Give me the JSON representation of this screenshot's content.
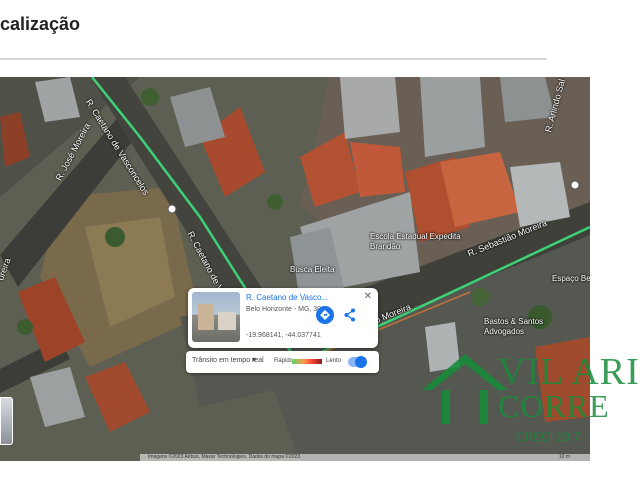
{
  "page": {
    "section_title": "calização"
  },
  "map": {
    "view": "satellite",
    "route_color": "#3dd178",
    "streets": {
      "jose_moreira": "R. José Moreira",
      "caetano_vasconcelos_top": "R. Caetano de Vasconcelos",
      "caetano_vasconcelos_mid": "R. Caetano de Vasconcelos",
      "sebastiao_moreira_right": "R. Sebastião Moreira",
      "sebastiao_moreira_main": "R. Sebastião Moreira",
      "arlindo_partial": "R. Arlindo Sal",
      "left_partial": "oreira"
    },
    "pois": {
      "escola_estadual": "Escola Estadual Expedita\nBrandão",
      "escola_estadual_sub": "",
      "busca_eleita": "Busca Eleita",
      "bastos_santos": "Bastos & Santos\nAdvogados",
      "espaco_partial": "Espaço Be"
    },
    "info_card": {
      "title": "R. Caetano de Vasco...",
      "city": "Belo Horizonte - MG, 30...",
      "coordinates": "-19.968141, -44.037741",
      "close_icon": "close-icon",
      "directions_icon": "directions-icon",
      "share_icon": "share-icon"
    },
    "traffic": {
      "label": "Trânsito em tempo real",
      "fast": "Rápido",
      "slow": "Lento"
    },
    "attribution": "Imagens ©2023 Airbus, Maxar Technologies, Dados do mapa ©2023",
    "scale": "10 m"
  },
  "watermark": {
    "line1": "VIL ARI",
    "line2": "CORRE",
    "creci": "CRECI 23.7"
  }
}
